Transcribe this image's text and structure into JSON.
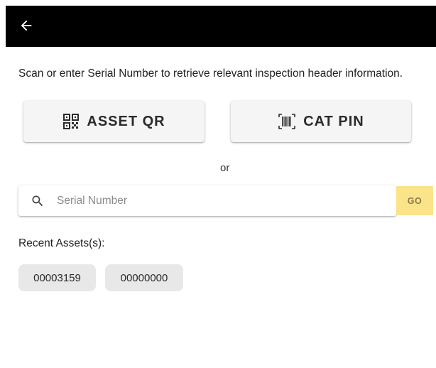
{
  "app_bar": {
    "back_icon": "arrow-left-icon",
    "background_color": "#000000"
  },
  "instructions": "Scan or enter Serial Number to retrieve relevant inspection header information.",
  "scan_buttons": {
    "asset_qr": {
      "label": "ASSET QR",
      "icon": "qr-code-icon"
    },
    "cat_pin": {
      "label": "CAT PIN",
      "icon": "barcode-icon"
    }
  },
  "separator_text": "or",
  "search": {
    "icon": "search-icon",
    "placeholder": "Serial Number",
    "value": "",
    "go_label": "GO",
    "go_color": "#fbe38a"
  },
  "recent": {
    "label": "Recent Assets(s):",
    "items": [
      "00003159",
      "00000000"
    ]
  }
}
